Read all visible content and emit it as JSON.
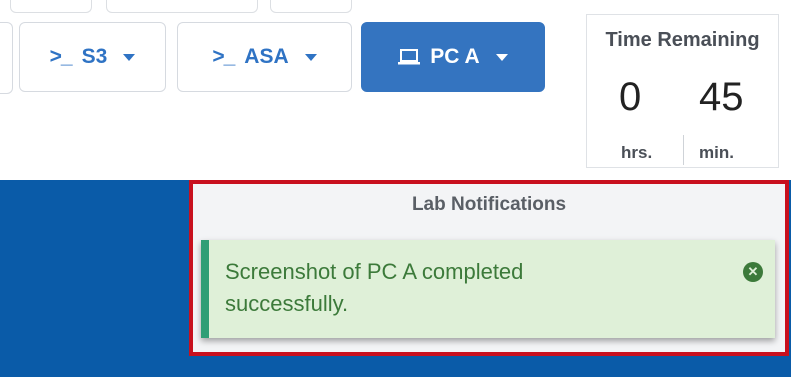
{
  "devices": [
    {
      "name": "S3",
      "type": "console"
    },
    {
      "name": "ASA",
      "type": "console"
    },
    {
      "name": "PC A",
      "type": "desktop",
      "active": true
    }
  ],
  "timer": {
    "title": "Time Remaining",
    "hours": "0",
    "minutes": "45",
    "hours_unit": "hrs.",
    "minutes_unit": "min."
  },
  "notifications": {
    "title": "Lab Notifications",
    "items": [
      {
        "message": "Screenshot of PC A completed successfully.",
        "status": "success"
      }
    ]
  },
  "colors": {
    "active_button": "#3474c0",
    "accent_text": "#2f73c4",
    "background_band": "#0a5ba8",
    "highlight_border": "#c8101e",
    "success_bg": "#dff0d8",
    "success_text": "#3c7a3a"
  }
}
